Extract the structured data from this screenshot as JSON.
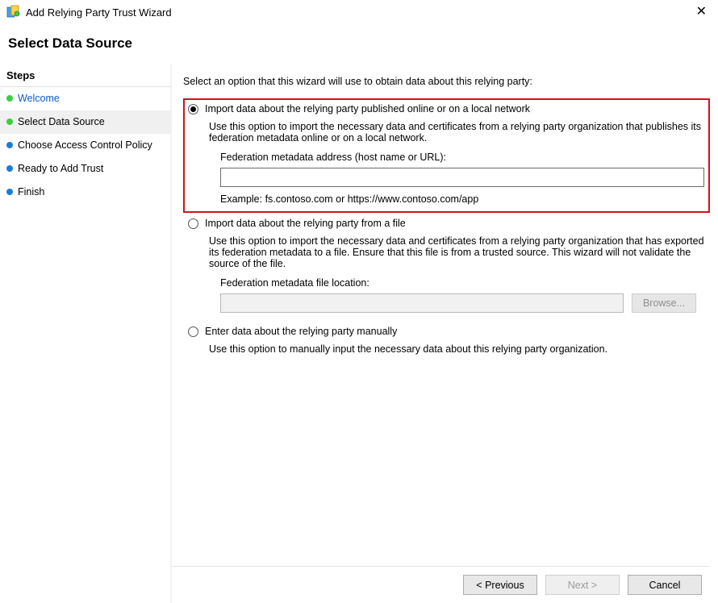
{
  "window": {
    "title": "Add Relying Party Trust Wizard",
    "heading": "Select Data Source"
  },
  "sidebar": {
    "header": "Steps",
    "items": [
      {
        "label": "Welcome",
        "status": "done",
        "current": false,
        "link": true
      },
      {
        "label": "Select Data Source",
        "status": "done",
        "current": true,
        "link": false
      },
      {
        "label": "Choose Access Control Policy",
        "status": "pending",
        "current": false,
        "link": false
      },
      {
        "label": "Ready to Add Trust",
        "status": "pending",
        "current": false,
        "link": false
      },
      {
        "label": "Finish",
        "status": "pending",
        "current": false,
        "link": false
      }
    ]
  },
  "main": {
    "instruction": "Select an option that this wizard will use to obtain data about this relying party:",
    "options": {
      "online": {
        "title": "Import data about the relying party published online or on a local network",
        "desc": "Use this option to import the necessary data and certificates from a relying party organization that publishes its federation metadata online or on a local network.",
        "field_label": "Federation metadata address (host name or URL):",
        "field_value": "",
        "example": "Example: fs.contoso.com or https://www.contoso.com/app",
        "selected": true
      },
      "file": {
        "title": "Import data about the relying party from a file",
        "desc": "Use this option to import the necessary data and certificates from a relying party organization that has exported its federation metadata to a file. Ensure that this file is from a trusted source.  This wizard will not validate the source of the file.",
        "field_label": "Federation metadata file location:",
        "field_value": "",
        "browse_label": "Browse...",
        "selected": false
      },
      "manual": {
        "title": "Enter data about the relying party manually",
        "desc": "Use this option to manually input the necessary data about this relying party organization.",
        "selected": false
      }
    }
  },
  "footer": {
    "previous": "< Previous",
    "next": "Next >",
    "cancel": "Cancel"
  }
}
